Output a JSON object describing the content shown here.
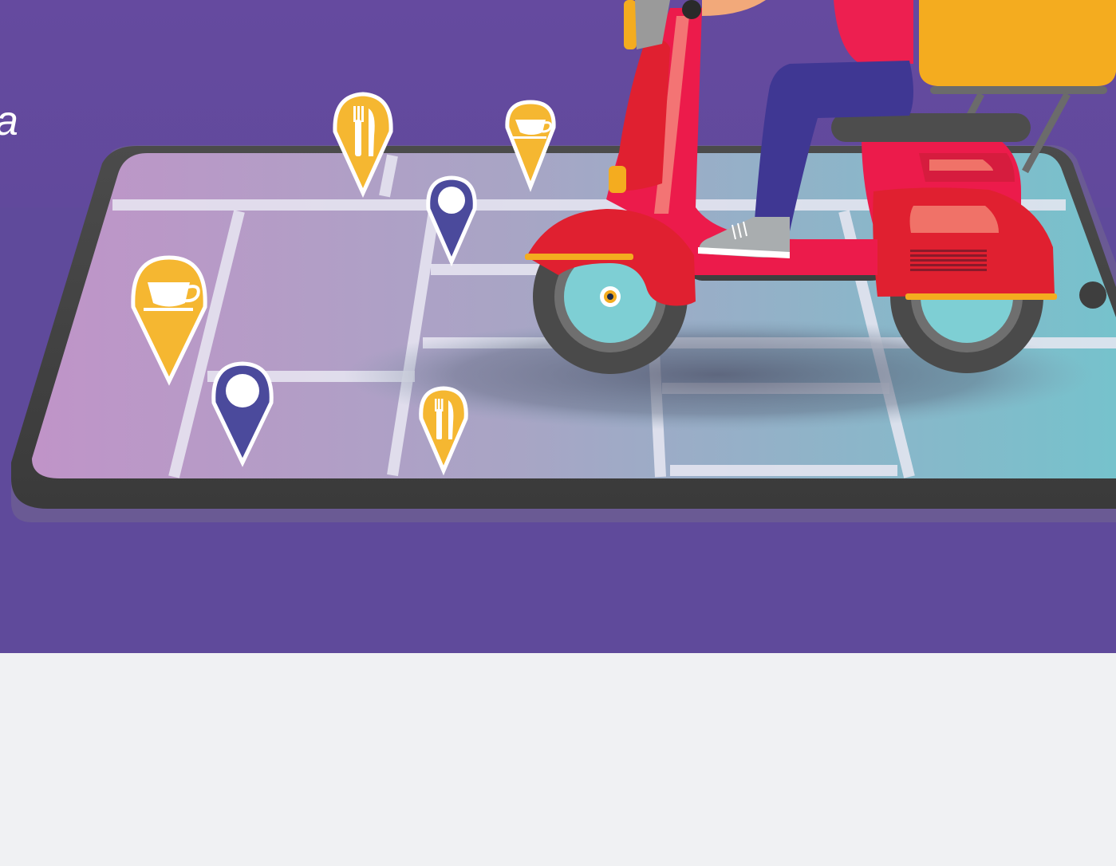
{
  "hero": {
    "partial_text": "a",
    "background_color": "#5f4a9b"
  },
  "map": {
    "pins": [
      {
        "icon": "cutlery-icon",
        "color": "#f5b731"
      },
      {
        "icon": "coffee-cup-icon",
        "color": "#f5b731"
      },
      {
        "icon": "location-icon",
        "color": "#4b4a9c"
      },
      {
        "icon": "coffee-cup-icon",
        "color": "#f5b731"
      },
      {
        "icon": "location-icon",
        "color": "#4b4a9c"
      },
      {
        "icon": "cutlery-icon",
        "color": "#f5b731"
      }
    ]
  },
  "colors": {
    "scooter_red": "#e02030",
    "delivery_box": "#f4ac1f",
    "rider_pants": "#3f3793",
    "wheel_teal": "#7ecfd4",
    "lower_background": "#f0f1f3"
  }
}
